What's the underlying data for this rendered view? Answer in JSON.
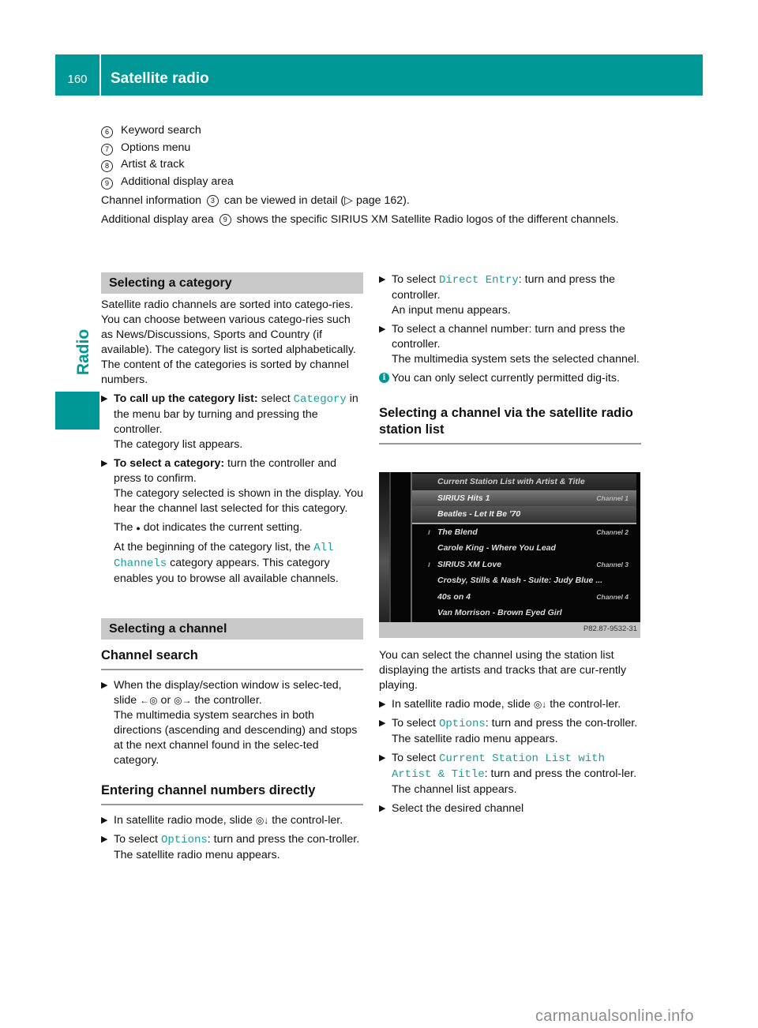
{
  "header": {
    "page_number": "160",
    "title": "Satellite radio"
  },
  "side_tab": {
    "label": "Radio"
  },
  "legend": [
    {
      "num": "6",
      "label": "Keyword search"
    },
    {
      "num": "7",
      "label": "Options menu"
    },
    {
      "num": "8",
      "label": "Artist & track"
    },
    {
      "num": "9",
      "label": "Additional display area"
    }
  ],
  "intro": {
    "p1_a": "Channel information",
    "p1_num": "3",
    "p1_b": "can be viewed in detail (",
    "p1_arrow": "▷",
    "p1_c": " page 162).",
    "p2_a": "Additional display area",
    "p2_num": "9",
    "p2_b": "shows the specific SIRIUS XM Satellite Radio logos of the different channels."
  },
  "category_section": {
    "heading": "Selecting a category",
    "body": "Satellite radio channels are sorted into catego-ries. You can choose between various catego-ries such as News/Discussions, Sports and Country (if available). The category list is sorted alphabetically. The content of the categories is sorted by channel numbers.",
    "step1_bold": "To call up the category list:",
    "step1_a": " select ",
    "step1_code": "Category",
    "step1_b": " in the menu bar by turning and pressing the controller.",
    "step1_result": "The category list appears.",
    "step2_bold": "To select a category:",
    "step2_a": " turn the controller and press to confirm.",
    "step2_result": "The category selected is shown in the display. You hear the channel last selected for this category.",
    "dot_note_a": "The",
    "dot_glyph": "●",
    "dot_note_b": "dot indicates the current setting.",
    "all_note_a": "At the beginning of the category list, the ",
    "all_code": "All Channels",
    "all_note_b": " category appears. This category enables you to browse all available channels."
  },
  "channel_section": {
    "heading": "Selecting a channel",
    "search_heading": "Channel search",
    "search_step_a": "When the display/section window is selec-ted, slide ",
    "search_ctrl_left": "←◎",
    "search_or": " or ",
    "search_ctrl_right": "◎→",
    "search_step_b": " the controller.",
    "search_result": "The multimedia system searches in both directions (ascending and descending) and stops at the next channel found in the selec-ted category.",
    "direct_heading": "Entering channel numbers directly",
    "direct_step1_a": "In satellite radio mode, slide ",
    "direct_ctrl_down": "◎↓",
    "direct_step1_b": " the control-ler.",
    "direct_step2_a": "To select ",
    "direct_step2_code": "Options",
    "direct_step2_b": ": turn and press the con-troller.",
    "direct_step2_result": "The satellite radio menu appears.",
    "direct_step3_a": "To select ",
    "direct_step3_code": "Direct Entry",
    "direct_step3_b": ": turn and press the controller.",
    "direct_step3_result": "An input menu appears.",
    "direct_step4": "To select a channel number: turn and press the controller.",
    "direct_step4_result": "The multimedia system sets the selected channel.",
    "info_note": "You can only select currently permitted dig-its."
  },
  "station_list_section": {
    "heading": "Selecting a channel via the satellite radio station list",
    "screenshot": {
      "title_row": "Current Station List with Artist & Title",
      "rows": [
        {
          "name": "SIRIUS Hits 1",
          "channel": "Channel 1",
          "state": "selected"
        },
        {
          "name": "Beatles - Let It Be '70",
          "channel": "",
          "state": "selected"
        },
        {
          "name": "The Blend",
          "channel": "Channel 2",
          "state": "normal"
        },
        {
          "name": "Carole King - Where You Lead",
          "channel": "",
          "state": "normal"
        },
        {
          "name": "SIRIUS XM Love",
          "channel": "Channel 3",
          "state": "normal"
        },
        {
          "name": "Crosby, Stills & Nash - Suite: Judy Blue ...",
          "channel": "",
          "state": "normal"
        },
        {
          "name": "40s on 4",
          "channel": "Channel 4",
          "state": "normal"
        },
        {
          "name": "Van Morrison - Brown Eyed Girl",
          "channel": "",
          "state": "normal"
        }
      ],
      "image_code": "P82.87-9532-31"
    },
    "body": "You can select the channel using the station list displaying the artists and tracks that are cur-rently playing.",
    "step1_a": "In satellite radio mode, slide ",
    "step1_ctrl": "◎↓",
    "step1_b": " the control-ler.",
    "step2_a": "To select ",
    "step2_code": "Options",
    "step2_b": ": turn and press the con-troller.",
    "step2_result": "The satellite radio menu appears.",
    "step3_a": "To select ",
    "step3_code": "Current Station List with Artist & Title",
    "step3_b": ": turn and press the control-ler.",
    "step3_result": "The channel list appears.",
    "step4": "Select the desired channel"
  },
  "watermark": "carmanualsonline.info",
  "colors": {
    "accent": "#009797",
    "section_bg": "#c8c8c8",
    "code_text": "#1a9d9d"
  }
}
